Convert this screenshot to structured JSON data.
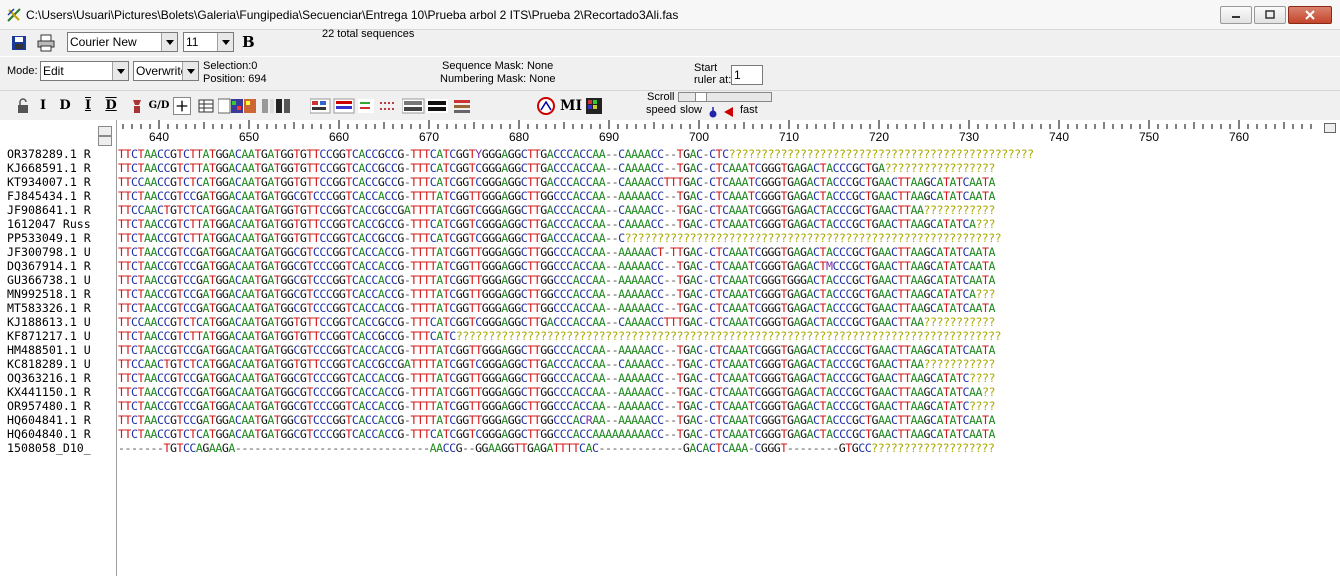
{
  "window": {
    "title": "C:\\Users\\Usuari\\Pictures\\Bolets\\Galeria\\Fungipedia\\Secuenciar\\Entrega 10\\Prueba arbol 2 ITS\\Prueba 2\\Recortado3Ali.fas"
  },
  "toolbar": {
    "font": "Courier New",
    "font_size": "11",
    "bold_label": "B",
    "total_sequences": "22 total sequences"
  },
  "status": {
    "mode_label": "Mode:",
    "mode_value": "Edit",
    "insert_mode": "Overwrite",
    "selection": "Selection:0",
    "position": "Position:  694",
    "sequence_mask": "Sequence Mask: None",
    "numbering_mask": "Numbering Mask: None",
    "start_ruler_label_1": "Start",
    "start_ruler_label_2": "ruler at:",
    "start_ruler_value": "1"
  },
  "edit_tools": [
    "I",
    "D",
    "I",
    "D",
    "G/D",
    "MI"
  ],
  "scroll": {
    "label_1": "Scroll",
    "label_2": "speed",
    "slow": "slow",
    "fast": "fast"
  },
  "ruler": {
    "positions": [
      "640",
      "650",
      "660",
      "670",
      "680",
      "690",
      "700",
      "710",
      "720",
      "730",
      "740",
      "750",
      "760"
    ]
  },
  "sequences": [
    {
      "name": "OR378289.1 R",
      "seq": "TTCTAACCGTCTTATGGACAATGATGGTGTTCCGGTCACCGCCG-TTTCATCGGTYGGGAGGCTTGACCCACCAA--CAAAACC--TGAC-CTC???????????????????????????????????????????????"
    },
    {
      "name": "KJ668591.1 R",
      "seq": "TTCTAACCGTCTTATGGACAATGATGGTGTTCCGGTCACCGCCG-TTTCATCGGTCGGGAGGCTTGACCCACCAA--CAAAACC--TGAC-CTCAAATCGGGTGAGACTACCCGCTGA?????????????????"
    },
    {
      "name": "KT934007.1 R",
      "seq": "TTCCAACCGTCTCATGGACAATGATGGTGTTCCGGTCACCGCCG-TTTCATCGGTCGGGAGGCTTGACCCACCAA--CAAAACCTTTGAC-CTCAAATCGGGTGAGACTACCCGCTGAACTTAAGCATATCAATA"
    },
    {
      "name": "FJ845434.1 R",
      "seq": "TTCTAACCGTCCGATGGACAATGATGGCGTCCCGGTCACCACCG-TTTTATCGGTTGGGAGGCTTGGCCCACCAA--AAAAACC--TGAC-CTCAAATCGGGTGAGACTACCCGCTGAACTTAAGCATATCAATA"
    },
    {
      "name": "JF908641.1 R",
      "seq": "TTCCAACTGTCTCATGGACAATGATGGTGTTCCGGTCACCGCCGATTTTATCGGTCGGGAGGCTTGACCCACCAA--CAAAACC--TGAC-CTCAAATCGGGTGAGACTACCCGCTGAACTTAA???????????"
    },
    {
      "name": "1612047 Russ",
      "seq": "TTCTAACCGTCTTATGGACAATGATGGTGTTCCGGTCACCGCCG-TTTCATCGGTCGGGAGGCTTGACCCACCAA--CAAAACC--TGAC-CTCAAATCGGGTGAGACTACCCGCTGAACTTAAGCATATCA???"
    },
    {
      "name": "PP533049.1 R",
      "seq": "TTCTAACCGTCTTATGGACAATGATGGTGTTCCGGTCACCGCCG-TTTCATCGGTCGGGAGGCTTGACCCACCAA--C??????????????????????????????????????????????????????????"
    },
    {
      "name": "JF300798.1 U",
      "seq": "TTCTAACCGTCCGATGGACAATGATGGCGTCCCGGTCACCACCG-TTTTATCGGTTGGGAGGCTTGGCCCACCAA--AAAAACT-TTGAC-CTCAAATCGGGTGAGACTACCCGCTGAACTTAAGCATATCAATA"
    },
    {
      "name": "DQ367914.1 R",
      "seq": "TTCTAACCGTCCGATGGACAATGATGGCGTCCCGGTCACCACCG-TTTTATCGGTTGGGAGGCTTGGCCCACCAA--AAAAACC--TGAC-CTCAAATCGGGTGAGACTMCCCGCTGAACTTAAGCATATCAATA"
    },
    {
      "name": "GU366738.1 U",
      "seq": "TTCTAACCGTCCGATGGACAATGATGGCGTCCCGGTCACCACCG-TTTTATCGGTTGGGAGGCTTGGCCCACCAA--AAAAACC--TGAC-CTCAAATCGGGTGGGACTACCCGCTGAACTTAAGCATATCAATA"
    },
    {
      "name": "MN992518.1 R",
      "seq": "TTCTAACCGTCCGATGGACAATGATGGCGTCCCGGTCACCACCG-TTTTATCGGTTGGGAGGCTTGGCCCACCAA--AAAAACC--TGAC-CTCAAATCGGGTGAGACTACCCGCTGAACTTAAGCATATCA???"
    },
    {
      "name": "MT583326.1 R",
      "seq": "TTCTAACCGTCCGATGGACAATGATGGCGTCCCGGTCACCACCG-TTTTATCGGTTGGGAGGCTTGGCCCACCAA--AAAAACC--TGAC-CTCAAATCGGGTGAGACTACCCGCTGAACTTAAGCATATCAATA"
    },
    {
      "name": "KJ188613.1 U",
      "seq": "TTCCAACCGTCTCATGGACAATGATGGTGTTCCGGTCACCGCCG-TTTCATCGGTCGGGAGGCTTGACCCACCAA--CAAAACCTTTGAC-CTCAAATCGGGTGAGACTACCCGCTGAACTTAA???????????"
    },
    {
      "name": "KF871217.1 U",
      "seq": "TTCTAACCGTCTTATGGACAATGATGGTGTTCCGGTCACCGCCG-TTTCATC????????????????????????????????????????????????????????????????????????????????????"
    },
    {
      "name": "HM488501.1 U",
      "seq": "TTCTAACCGTCCGATGGACAATGATGGCGTCCCGGTCACCACCG-TTTTATCGGTTGGGAGGCTTGGCCCACCAA--AAAAACC--TGAC-CTCAAATCGGGTGAGACTACCCGCTGAACTTAAGCATATCAATA"
    },
    {
      "name": "KC818289.1 U",
      "seq": "TTCCAACTGTCTCATGGACAATGATGGTGTTCCGGTCACCGCCGATTTTATCGGTCGGGAGGCTTGACCCACCAA--CAAAACC--TGAC-CTCAAATCGGGTGAGACTACCCGCTGAACTTAA???????????"
    },
    {
      "name": "OQ363216.1 R",
      "seq": "TTCTAACCGTCCGATGGACAATGATGGCGTCCCGGTCACCACCG-TTTTATCGGTTGGGAGGCTTGGCCCACCAA--AAAAACC--TGAC-CTCAAATCGGGTGAGACTACCCGCTGAACTTAAGCATATC????"
    },
    {
      "name": "KX441150.1 R",
      "seq": "TTCTAACCGTCCGATGGACAATGATGGCGTCCCGGTCACCACCG-TTTTATCGGTTGGGAGGCTTGGCCCACCAA--AAAAACC--TGAC-CTCAAATCGGGTGAGACTACCCGCTGAACTTAAGCATATCAA??"
    },
    {
      "name": "OR957480.1 R",
      "seq": "TTCTAACCGTCCGATGGACAATGATGGCGTCCCGGTCACCACCG-TTTTATCGGTTGGGAGGCTTGGCCCACCAA--AAAAACC--TGAC-CTCAAATCGGGTGAGACTACCCGCTGAACTTAAGCATATC????"
    },
    {
      "name": "HQ604841.1 R",
      "seq": "TTCTAACCGTCCGATGGACAATGATGGCGTCCCGGTCACCACCG-TTTTATCGGTTGGGAGGCTTGGCCCACRAA--AAAAACC--TGAC-CTCAAATCGGGTGAGACTACCCGCTGAACTTAAGCATATCAATA"
    },
    {
      "name": "HQ604840.1 R",
      "seq": "TTCTAACCGTCTCATGGACAATGATGGCGTCCCGGTCACCACCG-TTTCATCGGTCGGGAGGCTTGGCCCACCAAAAAAAAACC--TGAC-CTCAAATCGGGTGAGACTACCCGCTGAACTTAAGCATATCAATA"
    },
    {
      "name": "1508058_D10_",
      "seq": "-------TGTCCAGAAGA------------------------------AACCG--GGAAGGTTGAGATTTTCAC-------------GACACTCAAA-CGGGT--------GTGCC???????????????????"
    }
  ]
}
